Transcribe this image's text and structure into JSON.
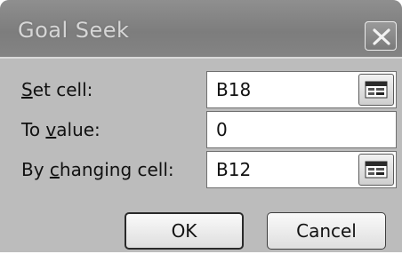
{
  "dialog": {
    "title": "Goal Seek",
    "set_cell": {
      "label_accel": "S",
      "label_rest": "et cell:",
      "value": "B18"
    },
    "to_value": {
      "label_pre": "To ",
      "label_accel": "v",
      "label_rest": "alue:",
      "value": "0"
    },
    "changing_cell": {
      "label_pre": "By ",
      "label_accel": "c",
      "label_rest": "hanging cell:",
      "value": "B12"
    },
    "ok_label": "OK",
    "cancel_label": "Cancel",
    "icons": {
      "close": "close-icon",
      "collapse": "collapse-dialog-icon"
    }
  }
}
